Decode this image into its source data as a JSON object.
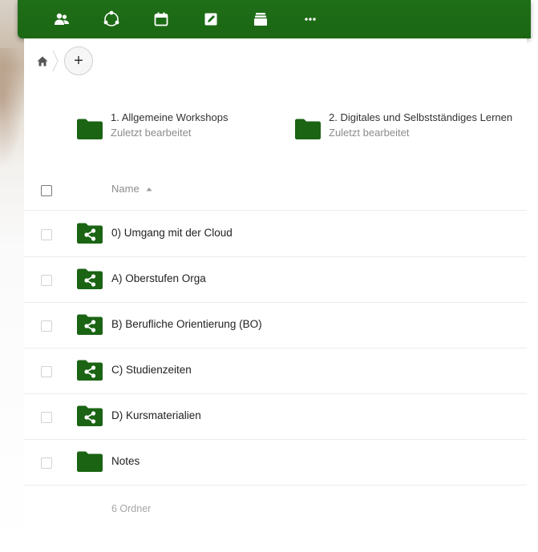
{
  "header": {
    "bg_color": "#1d6a15",
    "nav": [
      {
        "name": "contacts-icon"
      },
      {
        "name": "circles-icon"
      },
      {
        "name": "calendar-icon"
      },
      {
        "name": "notes-edit-icon"
      },
      {
        "name": "deck-icon"
      },
      {
        "name": "more-icon"
      }
    ]
  },
  "breadcrumb": {
    "home_icon": "home-icon",
    "add_label": "+"
  },
  "recent": [
    {
      "name": "1. Allgemeine Workshops",
      "subtitle": "Zuletzt bearbeitet"
    },
    {
      "name": "2. Digitales und Selbstständiges Lernen",
      "subtitle": "Zuletzt bearbeitet"
    }
  ],
  "list": {
    "column_name": "Name",
    "rows": [
      {
        "name": "0) Umgang mit der Cloud",
        "shared": true
      },
      {
        "name": "A) Oberstufen Orga",
        "shared": true
      },
      {
        "name": "B) Berufliche Orientierung (BO)",
        "shared": true
      },
      {
        "name": "C) Studienzeiten",
        "shared": true
      },
      {
        "name": "D) Kursmaterialien",
        "shared": true
      },
      {
        "name": "Notes",
        "shared": false
      }
    ],
    "summary": "6 Ordner"
  },
  "colors": {
    "folder": "#1a6413",
    "accent": "#1d6a15"
  }
}
